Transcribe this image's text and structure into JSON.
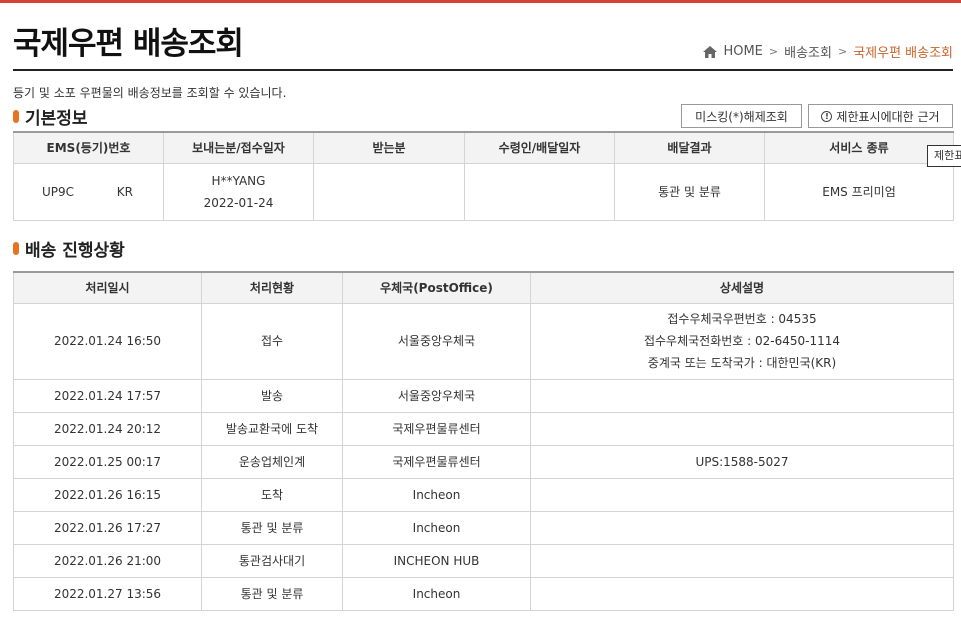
{
  "page": {
    "title": "국제우편 배송조회",
    "intro": "등기 및 소포 우편물의 배송정보를 조회할 수 있습니다."
  },
  "breadcrumb": {
    "home": "HOME",
    "level1": "배송조회",
    "current": "국제우편 배송조회"
  },
  "basic_info": {
    "section_title": "기본정보",
    "unmask_button": "미스킹(*)해제조회",
    "restriction_button": "제한표시에대한 근거",
    "tooltip": "제한표",
    "headers": [
      "EMS(등기)번호",
      "보내는분/접수일자",
      "받는분",
      "수령인/배달일자",
      "배달결과",
      "서비스 종류"
    ],
    "row": {
      "tracking_prefix": "UP9C",
      "tracking_suffix": "KR",
      "sender": "H**YANG",
      "date": "2022-01-24",
      "receiver": "",
      "recipient_date": "",
      "result": "통관 및 분류",
      "service": "EMS 프리미엄"
    }
  },
  "progress": {
    "section_title": "배송 진행상황",
    "headers": [
      "처리일시",
      "처리현황",
      "우체국(PostOffice)",
      "상세설명"
    ],
    "rows": [
      {
        "datetime": "2022.01.24 16:50",
        "status": "접수",
        "office": "서울중앙우체국",
        "detail": [
          "접수우체국우편번호 : 04535",
          "접수우체국전화번호 : 02-6450-1114",
          "중계국 또는 도착국가 : 대한민국(KR)"
        ]
      },
      {
        "datetime": "2022.01.24 17:57",
        "status": "발송",
        "office": "서울중앙우체국",
        "detail": [
          ""
        ]
      },
      {
        "datetime": "2022.01.24 20:12",
        "status": "발송교환국에 도착",
        "office": "국제우편물류센터",
        "detail": [
          ""
        ]
      },
      {
        "datetime": "2022.01.25 00:17",
        "status": "운송업체인계",
        "office": "국제우편물류센터",
        "detail": [
          "UPS:1588-5027"
        ]
      },
      {
        "datetime": "2022.01.26 16:15",
        "status": "도착",
        "office": "Incheon",
        "detail": [
          ""
        ]
      },
      {
        "datetime": "2022.01.26 17:27",
        "status": "통관 및 분류",
        "office": "Incheon",
        "detail": [
          ""
        ]
      },
      {
        "datetime": "2022.01.26 21:00",
        "status": "통관검사대기",
        "office": "INCHEON HUB",
        "detail": [
          ""
        ]
      },
      {
        "datetime": "2022.01.27 13:56",
        "status": "통관 및 분류",
        "office": "Incheon",
        "detail": [
          ""
        ]
      }
    ]
  },
  "colors": {
    "accent": "#e8731f",
    "breadcrumb_current": "#c8652a",
    "top_border": "#d8403a"
  }
}
